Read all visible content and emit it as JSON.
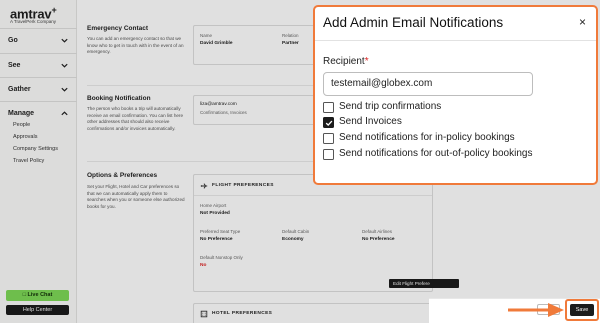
{
  "sidebar": {
    "logo": "amtrav",
    "logo_mark": "+",
    "logo_sub": "A TravelPerk Company",
    "nav": [
      {
        "label": "Go"
      },
      {
        "label": "See"
      },
      {
        "label": "Gather"
      },
      {
        "label": "Manage"
      }
    ],
    "manage_items": [
      "People",
      "Approvals",
      "Company Settings",
      "Travel Policy"
    ],
    "live_chat": "Live Chat",
    "help_center": "Help Center"
  },
  "main": {
    "emergency": {
      "title": "Emergency Contact",
      "desc": "You can add an emergency contact so that we know who to get in touch with in the event of an emergency.",
      "name_label": "Name",
      "name_value": "David Grimble",
      "relation_label": "Relation",
      "relation_value": "Partner"
    },
    "booking": {
      "title": "Booking Notification",
      "desc": "The person who books a trip will automatically receive an email confirmation. You can list here other addresses that should also receive confirmations and/or invoices automatically.",
      "email": "liza@amtrav.com",
      "email_sub": "Confirmations, Invoices"
    },
    "options": {
      "title": "Options & Preferences",
      "desc": "Set your Flight, Hotel and Car preferences so that we can automatically apply them to searches when you or someone else authorized books for you."
    },
    "flight": {
      "title": "FLIGHT PREFERENCES",
      "home_airport_label": "Home Airport",
      "home_airport_value": "Not Provided",
      "seat_label": "Preferred Seat Type",
      "seat_value": "No Preference",
      "cabin_label": "Default Cabin",
      "cabin_value": "Economy",
      "airlines_label": "Default Airlines",
      "airlines_value": "No Preference",
      "nonstop_label": "Default Nonstop Only",
      "nonstop_value": "No",
      "edit_button": "Edit Flight Prefere"
    },
    "hotel": {
      "title": "HOTEL PREFERENCES"
    }
  },
  "modal": {
    "title": "Add Admin Email Notifications",
    "close": "×",
    "recipient_label": "Recipient",
    "required_mark": "*",
    "recipient_value": "testemail@globex.com",
    "options": [
      {
        "label": "Send trip confirmations",
        "checked": false
      },
      {
        "label": "Send Invoices",
        "checked": true
      },
      {
        "label": "Send notifications for in-policy bookings",
        "checked": false
      },
      {
        "label": "Send notifications for out-of-policy bookings",
        "checked": false
      }
    ]
  },
  "footer": {
    "save": "Save"
  },
  "colors": {
    "accent_orange": "#f07a3a",
    "live_chat_green": "#7ed957",
    "dark": "#1c1c1c",
    "required_red": "#d22"
  }
}
